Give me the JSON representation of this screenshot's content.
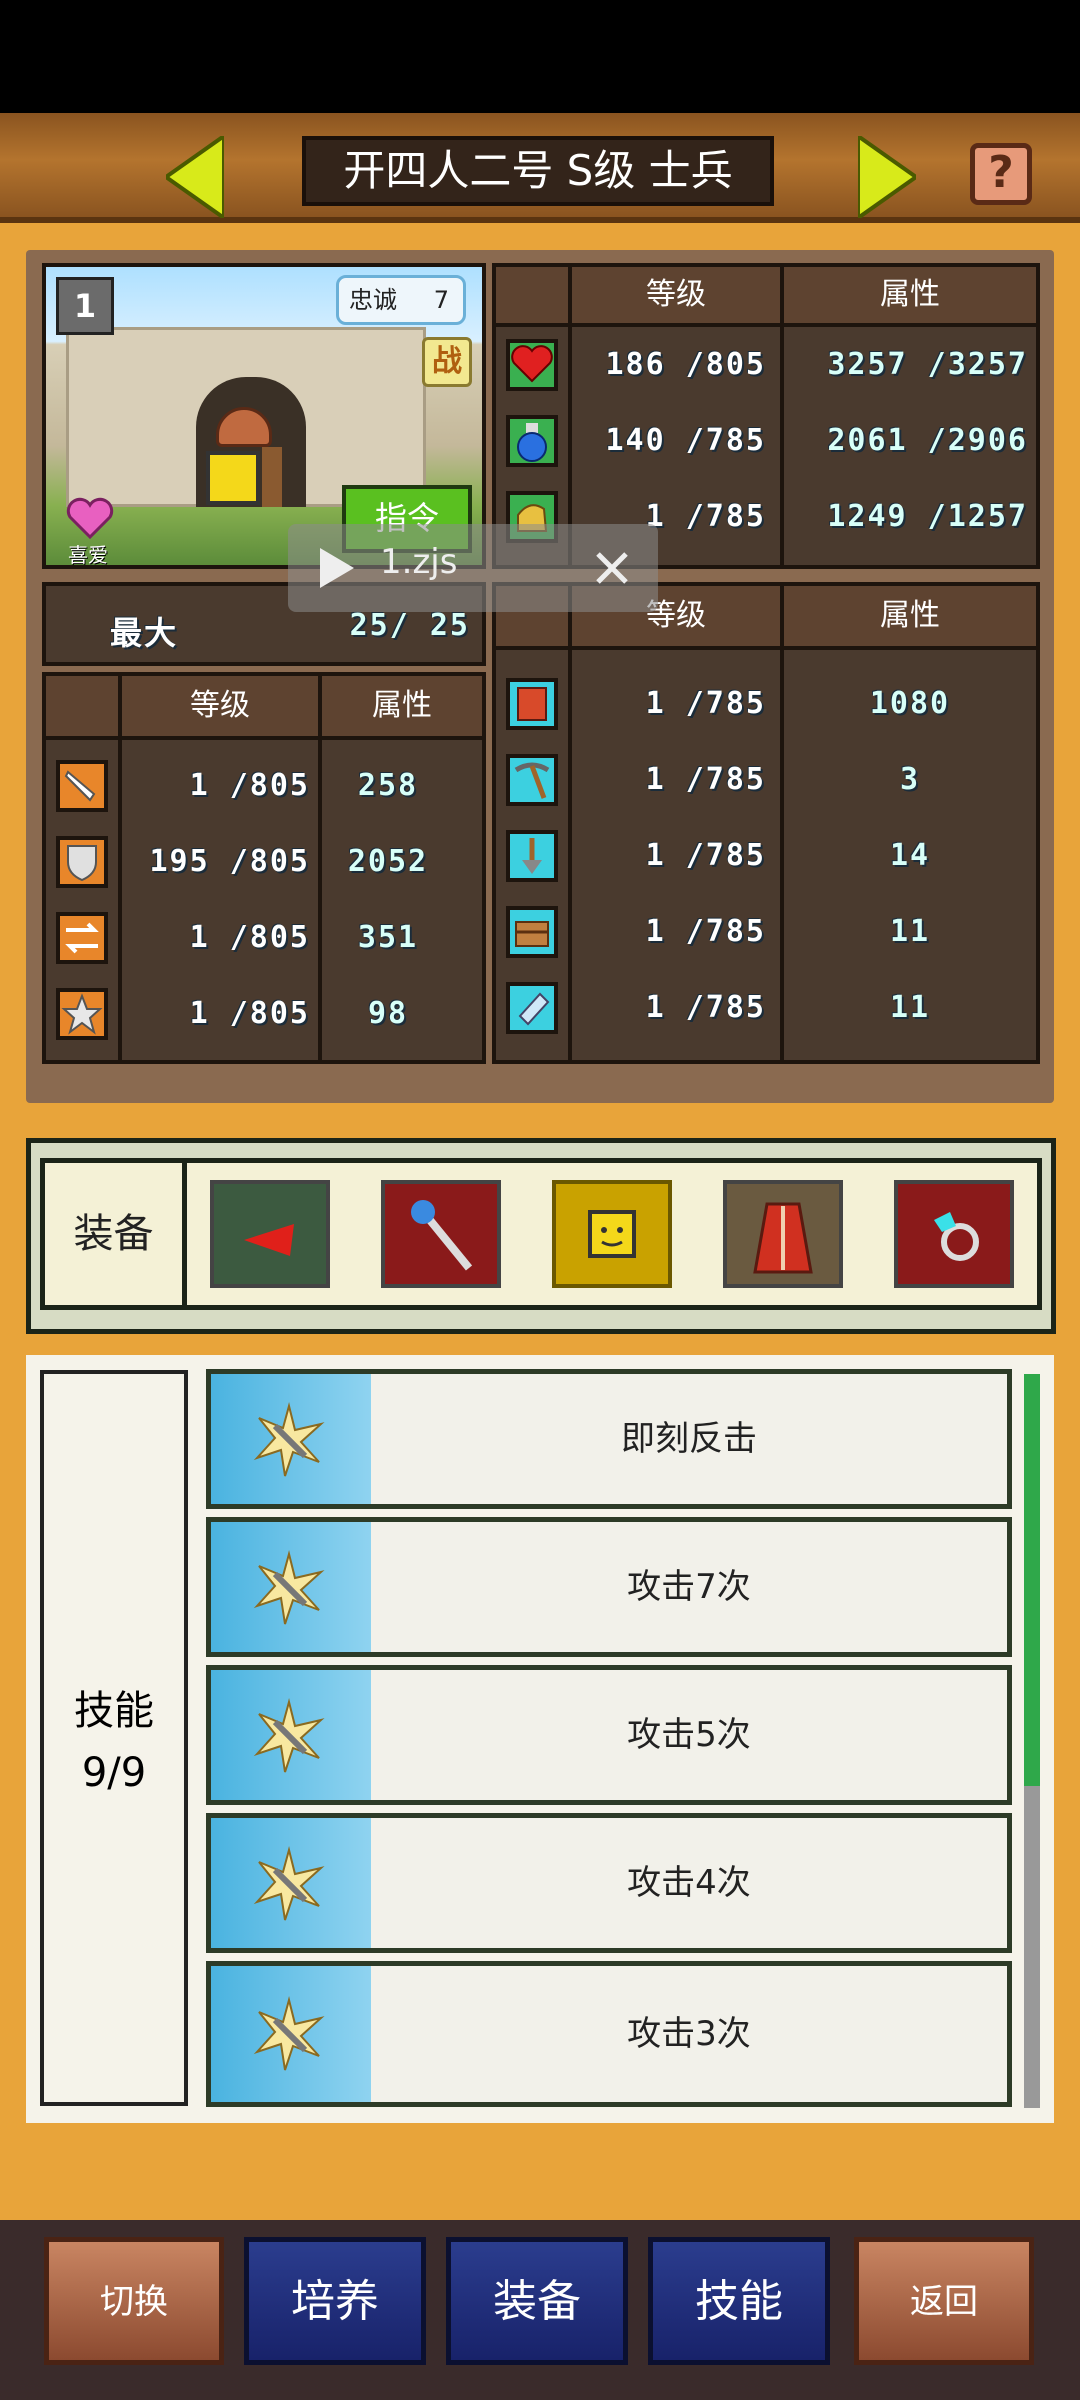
{
  "header": {
    "title": "开四人二号 S级 士兵"
  },
  "portrait": {
    "loyalty_label": "忠诚",
    "loyalty_value": "7",
    "battle_badge": "战",
    "like_label": "喜爱",
    "command_button": "指令",
    "level_badge": "1"
  },
  "overlay": {
    "file_label": "1.zjs"
  },
  "stats_top": {
    "col_level": "等级",
    "col_attr": "属性",
    "rows": [
      {
        "icon": "heart-icon",
        "level": "186 /805",
        "attr": "3257 /3257"
      },
      {
        "icon": "potion-icon",
        "level": "140 /785",
        "attr": "2061 /2906"
      },
      {
        "icon": "boot-icon",
        "level": "1 /785",
        "attr": "1249 /1257"
      }
    ]
  },
  "max_row": {
    "label": "最大",
    "value": "25/  25"
  },
  "stats_left": {
    "col_level": "等级",
    "col_attr": "属性",
    "rows": [
      {
        "icon": "sword-icon",
        "level": "1 /805",
        "attr": "258"
      },
      {
        "icon": "shield-icon",
        "level": "195 /805",
        "attr": "2052"
      },
      {
        "icon": "agility-icon",
        "level": "1 /805",
        "attr": "351"
      },
      {
        "icon": "star-icon",
        "level": "1 /805",
        "attr": "98"
      }
    ]
  },
  "stats_right": {
    "col_level": "等级",
    "col_attr": "属性",
    "rows": [
      {
        "icon": "book-icon",
        "level": "1 /785",
        "attr": "1080"
      },
      {
        "icon": "pickaxe-icon",
        "level": "1 /785",
        "attr": "3"
      },
      {
        "icon": "shovel-icon",
        "level": "1 /785",
        "attr": "14"
      },
      {
        "icon": "chest-icon",
        "level": "1 /785",
        "attr": "11"
      },
      {
        "icon": "gem-icon",
        "level": "1 /785",
        "attr": "11"
      }
    ]
  },
  "equipment": {
    "label": "装备",
    "slots": [
      {
        "icon": "red-arrowhead-icon",
        "bg": "#3c5a40"
      },
      {
        "icon": "staff-icon",
        "bg": "#8a1a1a"
      },
      {
        "icon": "smiley-card-icon",
        "bg": "#c9a200"
      },
      {
        "icon": "red-robe-icon",
        "bg": "#6a5a40"
      },
      {
        "icon": "ring-icon",
        "bg": "#8a1a1a"
      }
    ]
  },
  "skills": {
    "label": "技能",
    "count": "9/9",
    "items": [
      "即刻反击",
      "攻击7次",
      "攻击5次",
      "攻击4次",
      "攻击3次"
    ]
  },
  "bottom_nav": {
    "switch": "切换",
    "train": "培养",
    "equip": "装备",
    "skill": "技能",
    "back": "返回"
  },
  "colors": {
    "background": "#e8a43a",
    "panel": "#8a6a50",
    "table": "#4a3a2e",
    "skill_scroll": "#2fa84a"
  }
}
